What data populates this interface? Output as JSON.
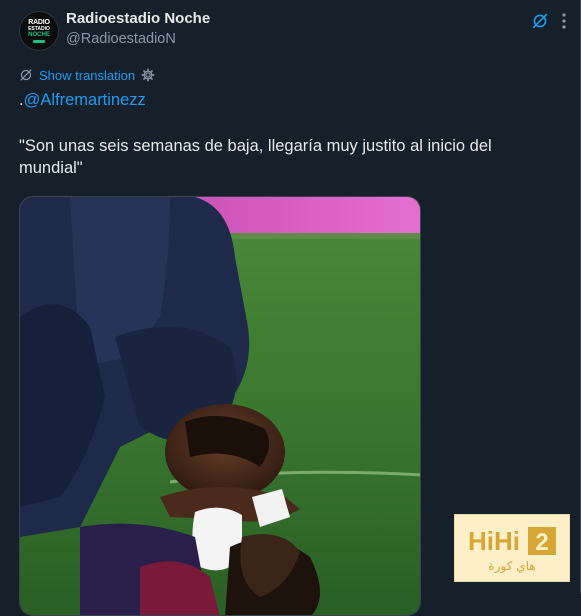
{
  "account": {
    "display_name": "Radioestadio Noche",
    "handle": "@RadioestadioN",
    "avatar_text": [
      "RADIO",
      "ESTADIO",
      "NOCHE"
    ]
  },
  "translation": {
    "label": "Show translation"
  },
  "tweet": {
    "prefix": ".",
    "mention": "@Alfremartinezz",
    "quote": "\"Son unas seis semanas de baja, llegaría muy justito al inicio del mundial\""
  },
  "media": {
    "alt": "Player lying injured on the pitch while being treated"
  },
  "watermark": {
    "brand": "HiHi2",
    "arabic": "هاي كورة"
  },
  "icons": {
    "grok": "grok-icon",
    "more": "more-options-icon",
    "translate": "translate-icon",
    "settings": "gear-icon"
  },
  "colors": {
    "background": "#15202b",
    "link": "#1d9bf0",
    "muted": "#8b98a5",
    "text": "#e7e9ea"
  }
}
